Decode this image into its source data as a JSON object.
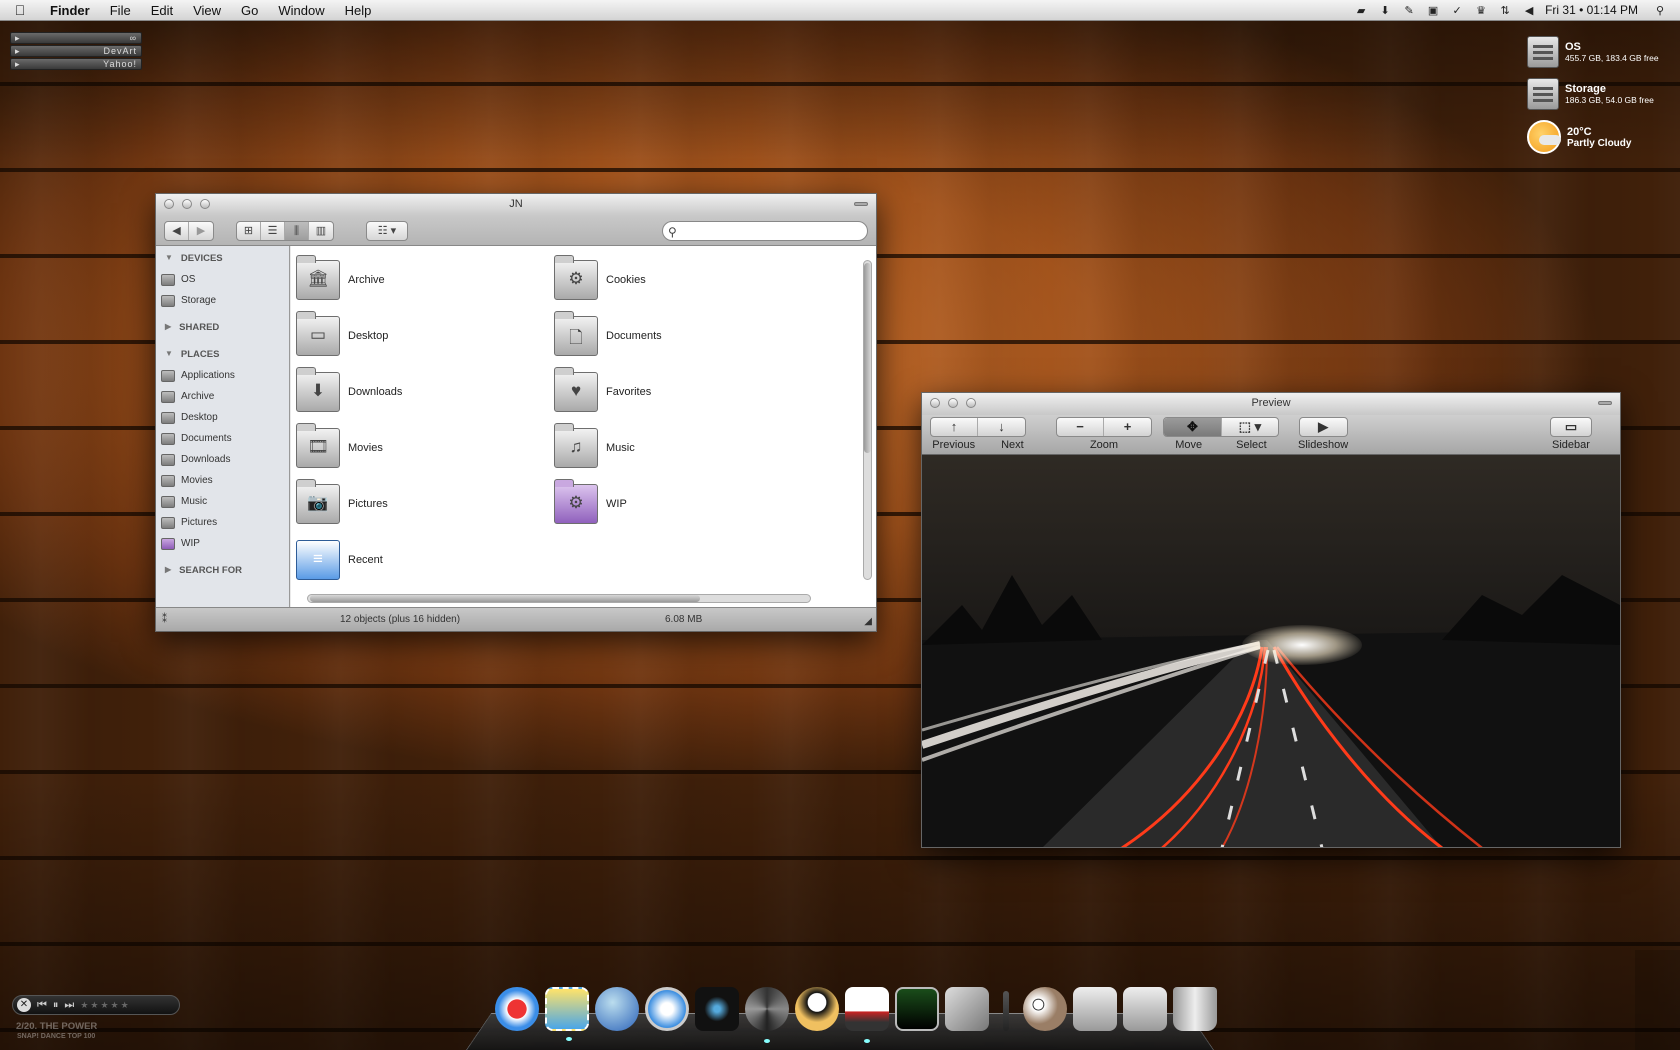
{
  "menubar": {
    "apple": "",
    "items": [
      "Finder",
      "File",
      "Edit",
      "View",
      "Go",
      "Window",
      "Help"
    ],
    "clock": "Fri 31 • 01:14 PM"
  },
  "dial_widget": {
    "rows": [
      {
        "label": "",
        "value": "∞"
      },
      {
        "label": "",
        "value": "DevArt"
      },
      {
        "label": "",
        "value": "Yahoo!"
      }
    ]
  },
  "drives": [
    {
      "name": "OS",
      "detail": "455.7 GB, 183.4 GB free"
    },
    {
      "name": "Storage",
      "detail": "186.3 GB, 54.0 GB free"
    }
  ],
  "weather": {
    "temp": "20°C",
    "desc": "Partly Cloudy"
  },
  "finder": {
    "title": "JN",
    "search_placeholder": "",
    "sidebar": {
      "devices_header": "DEVICES",
      "devices": [
        "OS",
        "Storage"
      ],
      "shared_header": "SHARED",
      "places_header": "PLACES",
      "places": [
        "Applications",
        "Archive",
        "Desktop",
        "Documents",
        "Downloads",
        "Movies",
        "Music",
        "Pictures",
        "WIP"
      ],
      "search_header": "SEARCH FOR"
    },
    "items": [
      {
        "label": "Archive",
        "icon": "archive-folder-icon",
        "glyph": "🏛"
      },
      {
        "label": "Cookies",
        "icon": "cookies-folder-icon",
        "glyph": "⚙"
      },
      {
        "label": "Desktop",
        "icon": "desktop-folder-icon",
        "glyph": "▭"
      },
      {
        "label": "Documents",
        "icon": "documents-folder-icon",
        "glyph": "🗋"
      },
      {
        "label": "Downloads",
        "icon": "downloads-folder-icon",
        "glyph": "⬇"
      },
      {
        "label": "Favorites",
        "icon": "favorites-folder-icon",
        "glyph": "♥"
      },
      {
        "label": "Movies",
        "icon": "movies-folder-icon",
        "glyph": "🎞"
      },
      {
        "label": "Music",
        "icon": "music-folder-icon",
        "glyph": "♫"
      },
      {
        "label": "Pictures",
        "icon": "pictures-folder-icon",
        "glyph": "📷"
      },
      {
        "label": "WIP",
        "icon": "wip-folder-icon",
        "glyph": "⚙"
      },
      {
        "label": "Recent",
        "icon": "recent-items-icon",
        "glyph": "≡"
      }
    ],
    "status_count": "12 objects (plus 16 hidden)",
    "status_size": "6.08 MB"
  },
  "preview": {
    "title": "Preview",
    "tools": {
      "previous": "Previous",
      "next": "Next",
      "zoom": "Zoom",
      "move": "Move",
      "select": "Select",
      "slideshow": "Slideshow",
      "sidebar": "Sidebar"
    }
  },
  "music": {
    "track": "2/20. THE POWER",
    "album": "SNAP! DANCE TOP 100"
  },
  "dock": [
    "app-1-icon",
    "mail-icon",
    "network-icon",
    "safari-icon",
    "itunes-icon",
    "dvd-icon",
    "panda-icon",
    "truck-icon",
    "terminal-icon",
    "photoshop-icon",
    "owl-icon",
    "favorites-stack-icon",
    "downloads-stack-icon",
    "trash-icon"
  ]
}
